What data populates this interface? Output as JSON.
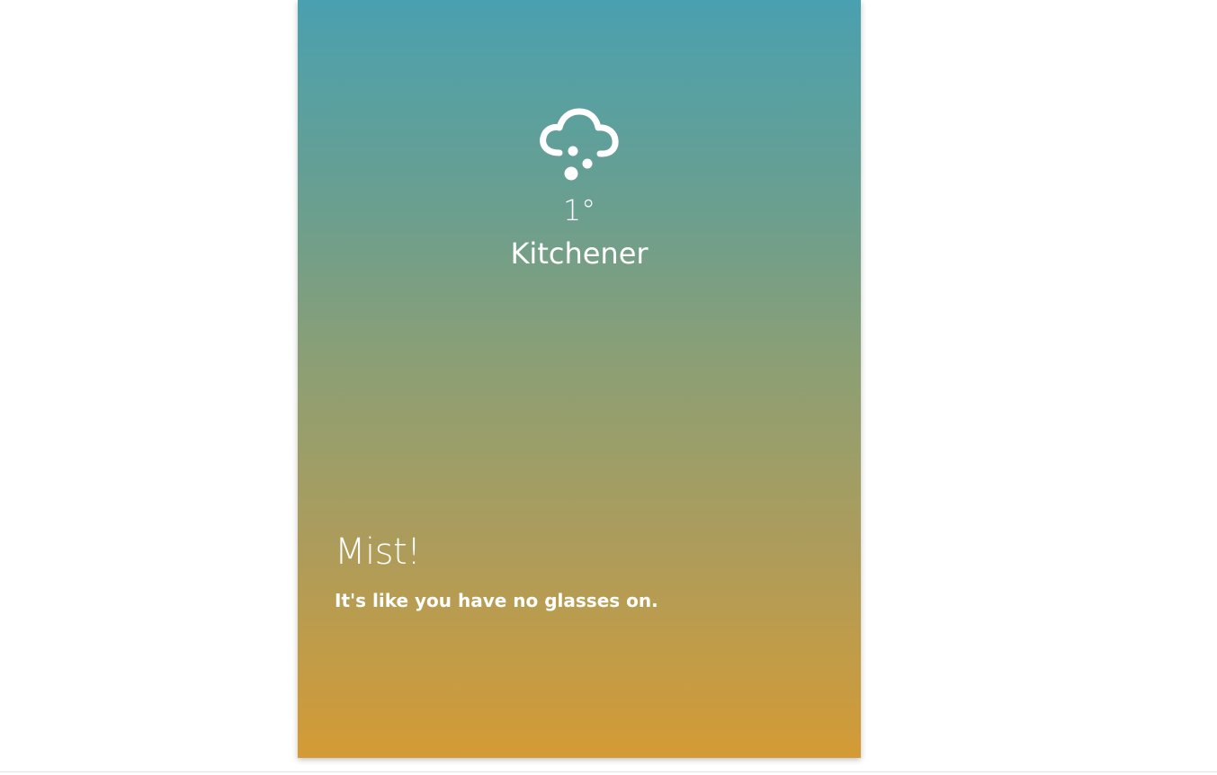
{
  "weather": {
    "icon": "cloud-hail-icon",
    "temperature": "1°",
    "city": "Kitchener",
    "condition": "Mist!",
    "description": "It's like you have no glasses on."
  },
  "colors": {
    "gradient_top": "#4aa0b0",
    "gradient_bottom": "#d49b35",
    "text": "#ffffff",
    "background": "#ffffff"
  }
}
